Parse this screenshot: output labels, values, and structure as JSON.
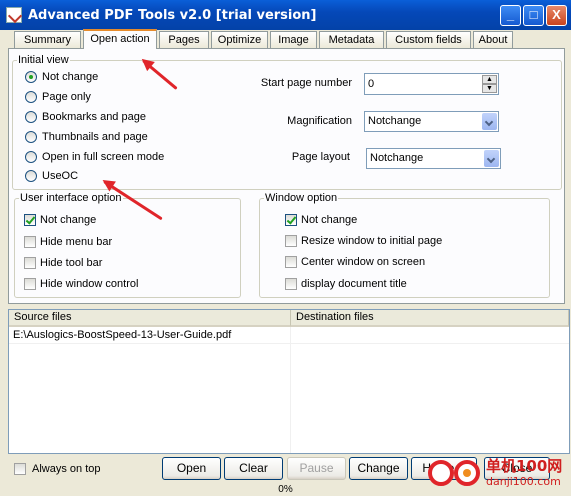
{
  "window": {
    "title": "Advanced PDF Tools  v2.0 [trial version]",
    "minimize": "_",
    "maximize": "□",
    "close": "X"
  },
  "tabs": [
    "Summary",
    "Open action",
    "Pages",
    "Optimize",
    "Image",
    "Metadata",
    "Custom fields",
    "About"
  ],
  "active_tab": "Open action",
  "initial_view": {
    "legend": "Initial view",
    "options": [
      "Not change",
      "Page only",
      "Bookmarks and page",
      "Thumbnails and page",
      "Open in full screen mode",
      "UseOC"
    ],
    "selected": "Not change"
  },
  "start_page": {
    "label": "Start page number",
    "value": "0"
  },
  "magnification": {
    "label": "Magnification",
    "value": "Notchange"
  },
  "page_layout": {
    "label": "Page layout",
    "value": "Notchange"
  },
  "ui_option": {
    "legend": "User interface option",
    "items": [
      {
        "label": "Not change",
        "checked": true
      },
      {
        "label": "Hide menu bar",
        "checked": false
      },
      {
        "label": "Hide tool bar",
        "checked": false
      },
      {
        "label": "Hide window control",
        "checked": false
      }
    ]
  },
  "window_option": {
    "legend": "Window option",
    "items": [
      {
        "label": "Not change",
        "checked": true
      },
      {
        "label": "Resize window to initial page",
        "checked": false
      },
      {
        "label": "Center window on screen",
        "checked": false
      },
      {
        "label": "display document title",
        "checked": false
      }
    ]
  },
  "files_table": {
    "columns": [
      "Source files",
      "Destination files"
    ],
    "rows": [
      {
        "source": "E:\\Auslogics-BoostSpeed-13-User-Guide.pdf",
        "destination": ""
      }
    ]
  },
  "always_on_top": {
    "label": "Always on top",
    "checked": false
  },
  "buttons": {
    "open": "Open",
    "clear": "Clear",
    "pause": "Pause",
    "change": "Change",
    "home": "Home P",
    "close": "Close"
  },
  "status": {
    "progress": "0%"
  },
  "watermark": {
    "line1": "单机100网",
    "line2": "danji100.com"
  },
  "colors": {
    "titlebar": "#0548b8",
    "accent_tab": "#e68b2c",
    "arrow": "#e0252a"
  }
}
